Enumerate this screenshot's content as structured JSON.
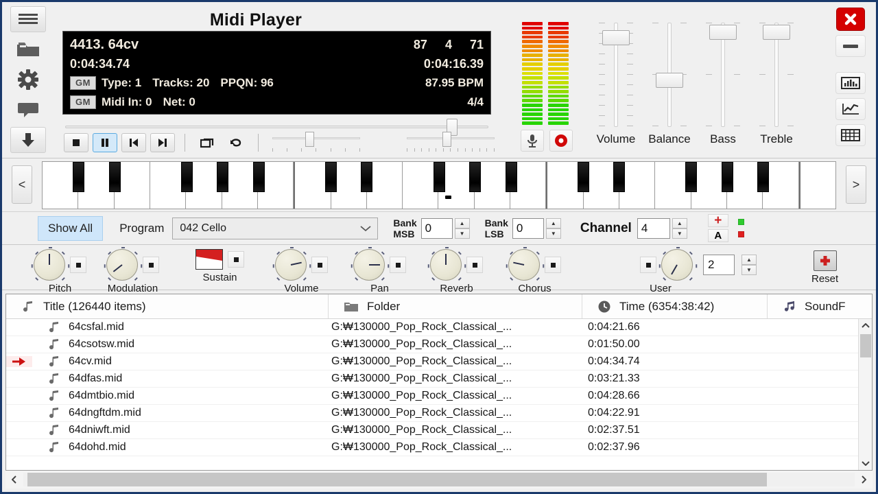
{
  "app": {
    "title": "Midi Player"
  },
  "left_rail": [
    {
      "name": "menu-icon",
      "label": "Menu"
    },
    {
      "name": "folder-icon",
      "label": "Open Folder"
    },
    {
      "name": "gear-icon",
      "label": "Settings"
    },
    {
      "name": "comment-icon",
      "label": "Comment"
    },
    {
      "name": "download-icon",
      "label": "Download"
    }
  ],
  "right_rail": [
    {
      "name": "close-icon",
      "label": "Close"
    },
    {
      "name": "minimize-icon",
      "label": "Minimize"
    },
    {
      "name": "bars-visualizer-icon",
      "label": "Bars"
    },
    {
      "name": "wave-visualizer-icon",
      "label": "Waveform"
    },
    {
      "name": "grid-view-icon",
      "label": "Grid"
    }
  ],
  "lcd": {
    "track_number_title": "4413. 64cv",
    "velocity_a": "87",
    "velocity_b": "4",
    "velocity_c": "71",
    "elapsed": "0:04:34.74",
    "remaining": "0:04:16.39",
    "gm_badge_1": "GM",
    "gm_badge_2": "GM",
    "type": "Type: 1",
    "tracks": "Tracks: 20",
    "ppqn": "PPQN: 96",
    "bpm": "87.95 BPM",
    "midi_in": "Midi In: 0",
    "net": "Net: 0",
    "time_signature": "4/4"
  },
  "transport": {
    "stop": "Stop",
    "pause": "Pause",
    "previous": "Previous",
    "next": "Next",
    "repeat": "Repeat",
    "undo": "Undo",
    "slider_a": "Tempo",
    "slider_b": "Transpose"
  },
  "vu": {
    "left": "VU Left",
    "right": "VU Right",
    "mic": "Microphone",
    "record": "Record"
  },
  "faders": [
    {
      "label": "Volume",
      "knob_top_pct": 8
    },
    {
      "label": "Balance",
      "knob_top_pct": 52
    },
    {
      "label": "Bass",
      "knob_top_pct": 2
    },
    {
      "label": "Treble",
      "knob_top_pct": 2
    }
  ],
  "keyboard": {
    "prev": "<",
    "next": ">"
  },
  "program_row": {
    "show_all": "Show All",
    "program_label": "Program",
    "program_value": "042 Cello",
    "bank_msb_label_1": "Bank",
    "bank_msb_label_2": "MSB",
    "bank_msb_value": "0",
    "bank_lsb_label_1": "Bank",
    "bank_lsb_label_2": "LSB",
    "bank_lsb_value": "0",
    "channel_label": "Channel",
    "channel_value": "4",
    "add_button": "+",
    "a_button": "A",
    "indicator_green": "#2fcc2f",
    "indicator_red": "#e02020"
  },
  "knobs": [
    {
      "label": "Pitch",
      "angle": 0
    },
    {
      "label": "Modulation",
      "angle": -128
    },
    {
      "label": "Sustain",
      "angle": 0
    },
    {
      "label": "Volume",
      "angle": 78
    },
    {
      "label": "Pan",
      "angle": 90
    },
    {
      "label": "Reverb",
      "angle": 0
    },
    {
      "label": "Chorus",
      "angle": -78
    },
    {
      "label": "User",
      "angle": -150
    }
  ],
  "user_value": "2",
  "reset_label": "Reset",
  "playlist": {
    "columns": [
      {
        "key": "title",
        "label": "Title (126440 items)",
        "icon": "note-icon"
      },
      {
        "key": "folder",
        "label": "Folder",
        "icon": "folder-icon"
      },
      {
        "key": "time",
        "label": "Time (6354:38:42)",
        "icon": "clock-icon"
      },
      {
        "key": "soundfont",
        "label": "SoundF",
        "icon": "music-icon"
      }
    ],
    "rows": [
      {
        "title": "64csfal.mid",
        "folder": "G:₩130000_Pop_Rock_Classical_...",
        "time": "0:04:21.66",
        "soundfont": "",
        "playing": false
      },
      {
        "title": "64csotsw.mid",
        "folder": "G:₩130000_Pop_Rock_Classical_...",
        "time": "0:01:50.00",
        "soundfont": "",
        "playing": false
      },
      {
        "title": "64cv.mid",
        "folder": "G:₩130000_Pop_Rock_Classical_...",
        "time": "0:04:34.74",
        "soundfont": "",
        "playing": true
      },
      {
        "title": "64dfas.mid",
        "folder": "G:₩130000_Pop_Rock_Classical_...",
        "time": "0:03:21.33",
        "soundfont": "",
        "playing": false
      },
      {
        "title": "64dmtbio.mid",
        "folder": "G:₩130000_Pop_Rock_Classical_...",
        "time": "0:04:28.66",
        "soundfont": "",
        "playing": false
      },
      {
        "title": "64dngftdm.mid",
        "folder": "G:₩130000_Pop_Rock_Classical_...",
        "time": "0:04:22.91",
        "soundfont": "",
        "playing": false
      },
      {
        "title": "64dniwft.mid",
        "folder": "G:₩130000_Pop_Rock_Classical_...",
        "time": "0:02:37.51",
        "soundfont": "",
        "playing": false
      },
      {
        "title": "64dohd.mid",
        "folder": "G:₩130000_Pop_Rock_Classical_...",
        "time": "0:02:37.96",
        "soundfont": "",
        "playing": false
      }
    ]
  },
  "colors": {
    "accent_blue": "#cfe6fa",
    "close_red": "#d40000",
    "playing_arrow": "#cc1111",
    "window_border": "#1a3a6b"
  }
}
